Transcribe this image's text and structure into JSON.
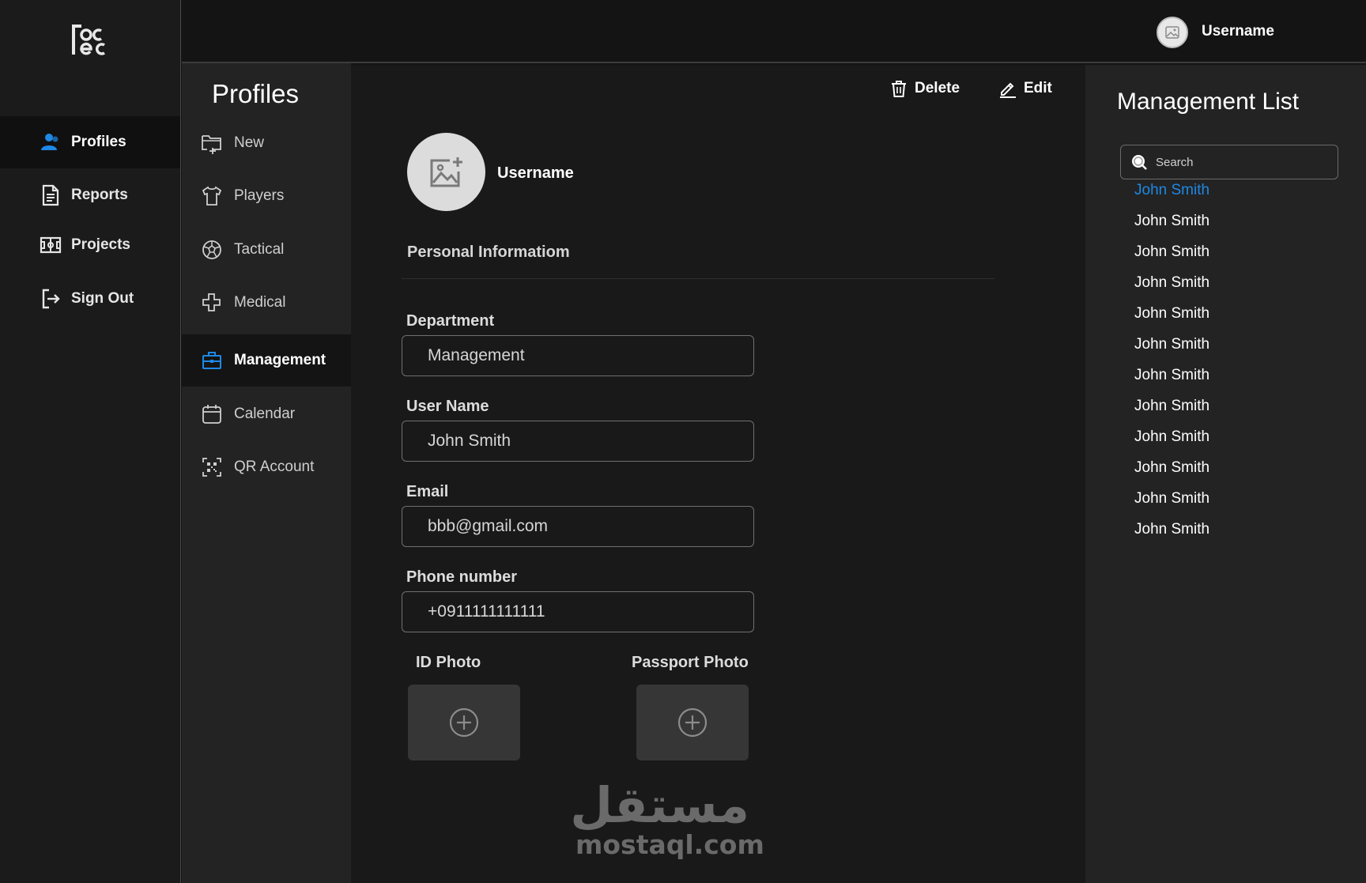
{
  "nav": {
    "items": [
      {
        "label": "Profiles",
        "icon": "user-icon"
      },
      {
        "label": "Reports",
        "icon": "document-icon"
      },
      {
        "label": "Projects",
        "icon": "field-icon"
      },
      {
        "label": "Sign Out",
        "icon": "sign-out-icon"
      }
    ],
    "active": "Profiles"
  },
  "topbar": {
    "username": "Username"
  },
  "submenu": {
    "title": "Profiles",
    "items": [
      {
        "label": "New",
        "icon": "new-folder-icon"
      },
      {
        "label": "Players",
        "icon": "shirt-icon"
      },
      {
        "label": "Tactical",
        "icon": "ball-icon"
      },
      {
        "label": "Medical",
        "icon": "medical-cross-icon"
      },
      {
        "label": "Management",
        "icon": "briefcase-icon"
      },
      {
        "label": "Calendar",
        "icon": "calendar-icon"
      },
      {
        "label": "QR Account",
        "icon": "qr-icon"
      }
    ],
    "active": "Management"
  },
  "toolbar": {
    "delete_label": "Delete",
    "edit_label": "Edit"
  },
  "profile": {
    "username": "Username",
    "section_title": "Personal Informatiom",
    "fields": [
      {
        "label": "Department",
        "value": "Management"
      },
      {
        "label": "User Name",
        "value": "John Smith"
      },
      {
        "label": "Email",
        "value": "bbb@gmail.com"
      },
      {
        "label": "Phone number",
        "value": "+0911111111111"
      }
    ],
    "photos": [
      {
        "label": "ID Photo"
      },
      {
        "label": "Passport Photo"
      }
    ]
  },
  "watermark": {
    "arabic": "مستقل",
    "latin": "mostaql.com"
  },
  "list": {
    "title": "Management List",
    "search_placeholder": "Search",
    "items": [
      "John Smith",
      "John Smith",
      "John Smith",
      "John Smith",
      "John Smith",
      "John Smith",
      "John Smith",
      "John Smith",
      "John Smith",
      "John Smith",
      "John Smith",
      "John Smith"
    ],
    "selected_index": 0
  },
  "colors": {
    "accent": "#1e88e5",
    "background": "#141414",
    "panel": "#232323"
  }
}
